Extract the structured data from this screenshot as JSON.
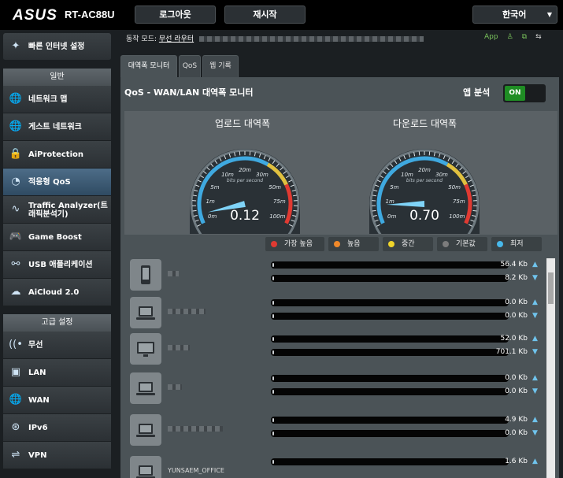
{
  "header": {
    "brand": "ASUS",
    "model": "RT-AC88U",
    "logout_label": "로그아웃",
    "restart_label": "재시작",
    "language": "한국어"
  },
  "sidebar": {
    "quick_setup": "빠른 인터넷 설정",
    "general_header": "일반",
    "general_items": [
      {
        "label": "네트워크 맵",
        "icon": "globe-icon"
      },
      {
        "label": "게스트 네트워크",
        "icon": "globe-icon"
      },
      {
        "label": "AiProtection",
        "icon": "lock-icon"
      },
      {
        "label": "적응형 QoS",
        "icon": "gauge-icon",
        "active": true
      },
      {
        "label": "Traffic Analyzer(트래픽분석기)",
        "icon": "chart-icon"
      },
      {
        "label": "Game Boost",
        "icon": "gamepad-icon"
      },
      {
        "label": "USB 애플리케이션",
        "icon": "usb-icon"
      },
      {
        "label": "AiCloud 2.0",
        "icon": "cloud-icon"
      }
    ],
    "advanced_header": "고급 설정",
    "advanced_items": [
      {
        "label": "무선",
        "icon": "wireless-icon"
      },
      {
        "label": "LAN",
        "icon": "lan-icon"
      },
      {
        "label": "WAN",
        "icon": "wan-icon"
      },
      {
        "label": "IPv6",
        "icon": "ipv6-icon"
      },
      {
        "label": "VPN",
        "icon": "vpn-icon"
      }
    ]
  },
  "status": {
    "mode_label": "동작 모드:",
    "mode_value": "무선 라우터",
    "app_label": "App"
  },
  "tabs": [
    "대역폭 모니터",
    "QoS",
    "웹 기록"
  ],
  "panel": {
    "title": "QoS - WAN/LAN 대역폭 모니터",
    "app_analysis_label": "앱 분석",
    "toggle_state": "ON",
    "upload_title": "업로드 대역폭",
    "download_title": "다운로드 대역폭",
    "upload_value": "0.12",
    "download_value": "0.70",
    "gauge_unit": "bits per second",
    "gauge_ticks": [
      "0m",
      "1m",
      "5m",
      "10m",
      "20m",
      "30m",
      "50m",
      "75m",
      "100m"
    ]
  },
  "legend": [
    {
      "label": "가장 높음",
      "color": "#e03a32"
    },
    {
      "label": "높음",
      "color": "#f0892a"
    },
    {
      "label": "중간",
      "color": "#f0d52a"
    },
    {
      "label": "기본값",
      "color": "#7c7c7c"
    },
    {
      "label": "최저",
      "color": "#48b8ea"
    }
  ],
  "devices": [
    {
      "type": "phone-icon",
      "name": "",
      "up": "56.4 Kb",
      "down": "8.2 Kb"
    },
    {
      "type": "laptop-icon",
      "name": "",
      "up": "0.0 Kb",
      "down": "0.0 Kb"
    },
    {
      "type": "monitor-icon",
      "name": "",
      "up": "52.0 Kb",
      "down": "701.1 Kb"
    },
    {
      "type": "laptop-icon",
      "name": "",
      "up": "0.0 Kb",
      "down": "0.0 Kb"
    },
    {
      "type": "laptop-icon",
      "name": "",
      "up": "4.9 Kb",
      "down": "0.0 Kb"
    },
    {
      "type": "laptop-icon",
      "name": "YUNSAEM_OFFICE",
      "up": "1.6 Kb",
      "down": ""
    }
  ]
}
